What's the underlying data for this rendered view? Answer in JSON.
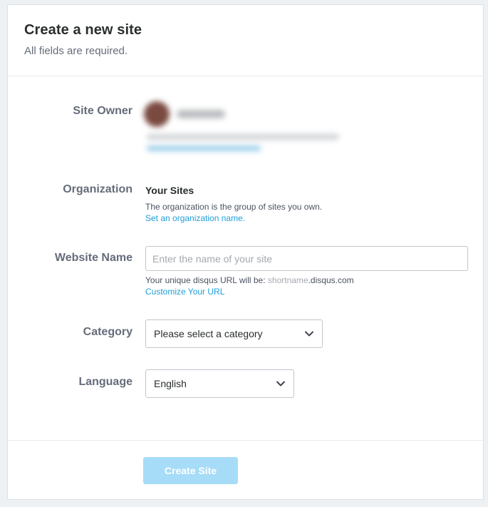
{
  "header": {
    "title": "Create a new site",
    "subtitle": "All fields are required."
  },
  "site_owner": {
    "label": "Site Owner"
  },
  "organization": {
    "label": "Organization",
    "name": "Your Sites",
    "help": "The organization is the group of sites you own.",
    "link": "Set an organization name."
  },
  "website_name": {
    "label": "Website Name",
    "placeholder": "Enter the name of your site",
    "value": "",
    "url_prefix": "Your unique disqus URL will be: ",
    "url_shortname": "shortname",
    "url_domain": ".disqus.com",
    "customize_link": "Customize Your URL"
  },
  "category": {
    "label": "Category",
    "selected": "Please select a category"
  },
  "language": {
    "label": "Language",
    "selected": "English"
  },
  "footer": {
    "create_button": "Create Site"
  },
  "colors": {
    "accent": "#1f9fd8",
    "button_disabled": "#a6dcf7"
  },
  "icons": {
    "avatar": "avatar",
    "dropdown": "chevron-down-icon"
  }
}
